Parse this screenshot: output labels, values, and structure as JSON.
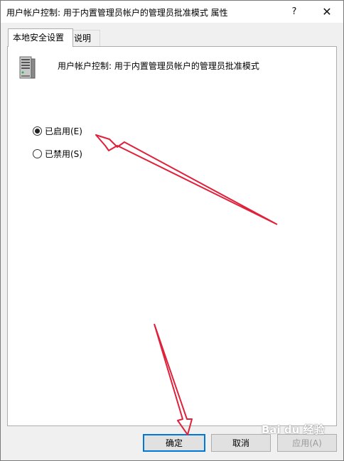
{
  "window": {
    "title": "用户帐户控制: 用于内置管理员帐户的管理员批准模式 属性",
    "help_glyph": "?",
    "close_glyph": "✕"
  },
  "tabs": [
    {
      "label": "本地安全设置",
      "active": true
    },
    {
      "label": "说明",
      "active": false
    }
  ],
  "policy": {
    "icon": "server-policy-icon",
    "title": "用户帐户控制: 用于内置管理员帐户的管理员批准模式"
  },
  "options": [
    {
      "label": "已启用(E)",
      "checked": true
    },
    {
      "label": "已禁用(S)",
      "checked": false
    }
  ],
  "buttons": {
    "ok": "确定",
    "cancel": "取消",
    "apply": "应用(A)"
  },
  "watermark": "Bai du 经验",
  "annotation_color": "#e0213c"
}
